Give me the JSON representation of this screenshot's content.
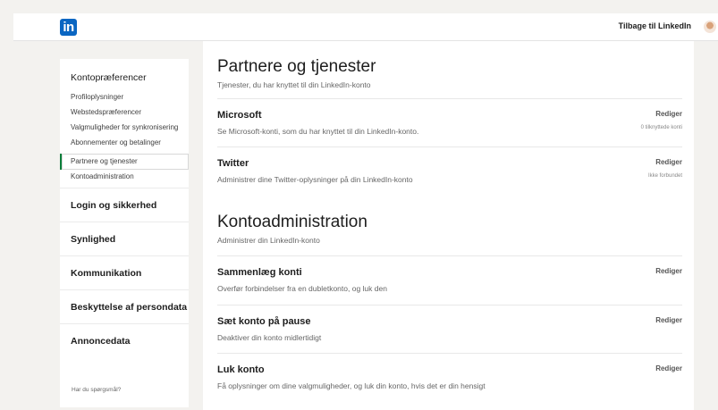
{
  "header": {
    "logo": "in",
    "back_link": "Tilbage til LinkedIn"
  },
  "sidebar": {
    "title": "Kontopræferencer",
    "items": [
      {
        "label": "Profiloplysninger"
      },
      {
        "label": "Webstedspræferencer"
      },
      {
        "label": "Valgmuligheder for synkronisering"
      },
      {
        "label": "Abonnementer og betalinger"
      },
      {
        "label": "Partnere og tjenester",
        "active": true
      },
      {
        "label": "Kontoadministration"
      }
    ],
    "sections": [
      "Login og sikkerhed",
      "Synlighed",
      "Kommunikation",
      "Beskyttelse af persondata",
      "Annoncedata"
    ],
    "help": "Har du spørgsmål?"
  },
  "main": {
    "partners": {
      "title": "Partnere og tjenester",
      "subtitle": "Tjenester, du har knyttet til din LinkedIn-konto",
      "rows": [
        {
          "title": "Microsoft",
          "desc": "Se Microsoft-konti, som du har knyttet til din LinkedIn-konto.",
          "edit": "Rediger",
          "status": "0 tilknyttede konti"
        },
        {
          "title": "Twitter",
          "desc": "Administrer dine Twitter-oplysninger på din LinkedIn-konto",
          "edit": "Rediger",
          "status": "Ikke forbundet"
        }
      ]
    },
    "account": {
      "title": "Kontoadministration",
      "subtitle": "Administrer din LinkedIn-konto",
      "rows": [
        {
          "title": "Sammenlæg konti",
          "desc": "Overfør forbindelser fra en dubletkonto, og luk den",
          "edit": "Rediger"
        },
        {
          "title": "Sæt konto på pause",
          "desc": "Deaktiver din konto midlertidigt",
          "edit": "Rediger"
        },
        {
          "title": "Luk konto",
          "desc": "Få oplysninger om dine valgmuligheder, og luk din konto, hvis det er din hensigt",
          "edit": "Rediger"
        }
      ]
    }
  }
}
